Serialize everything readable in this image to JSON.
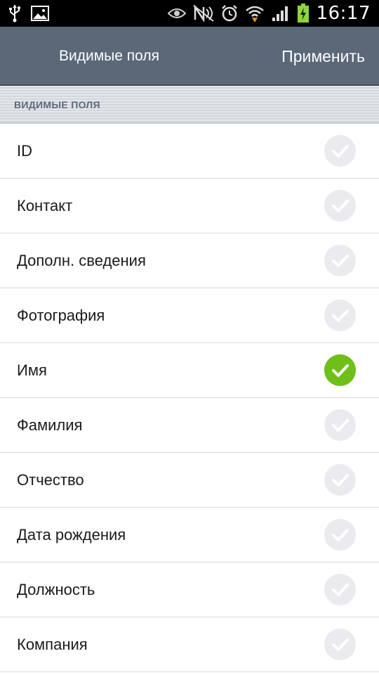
{
  "status_bar": {
    "time": "16:17",
    "left_icons": [
      "usb-icon",
      "image-icon"
    ],
    "right_icons": [
      "eye-icon",
      "nfc-icon",
      "alarm-icon",
      "wifi-icon",
      "signal-icon",
      "battery-charging-icon"
    ]
  },
  "action_bar": {
    "title": "Видимые поля",
    "apply_label": "Применить"
  },
  "section": {
    "header": "ВИДИМЫЕ ПОЛЯ"
  },
  "fields": [
    {
      "label": "ID",
      "checked": false
    },
    {
      "label": "Контакт",
      "checked": false
    },
    {
      "label": "Дополн. сведения",
      "checked": false
    },
    {
      "label": "Фотография",
      "checked": false
    },
    {
      "label": "Имя",
      "checked": true
    },
    {
      "label": "Фамилия",
      "checked": false
    },
    {
      "label": "Отчество",
      "checked": false
    },
    {
      "label": "Дата рождения",
      "checked": false
    },
    {
      "label": "Должность",
      "checked": false
    },
    {
      "label": "Компания",
      "checked": false
    }
  ],
  "colors": {
    "action_bar": "#5a6878",
    "checked": "#6fbf1a",
    "unchecked": "#ebebef"
  }
}
